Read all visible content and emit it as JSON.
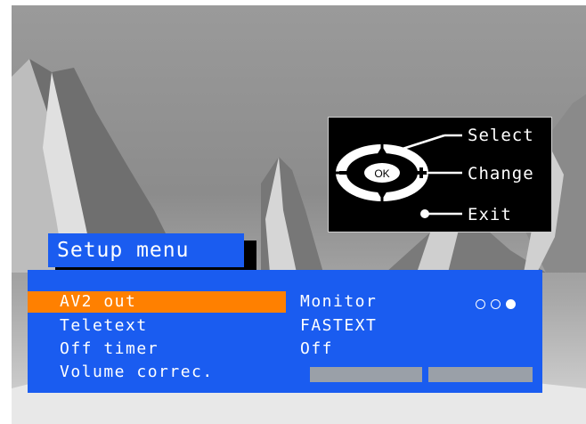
{
  "menu": {
    "title": "Setup menu",
    "items": [
      {
        "label": "AV2 out",
        "value": "Monitor",
        "selected": true
      },
      {
        "label": "Teletext",
        "value": "FASTEXT",
        "selected": false
      },
      {
        "label": "Off timer",
        "value": "Off",
        "selected": false
      },
      {
        "label": "Volume correc.",
        "value": "",
        "selected": false
      }
    ],
    "option_dots": {
      "count": 3,
      "selected_index": 2
    }
  },
  "help": {
    "select_label": "Select",
    "change_label": "Change",
    "exit_label": "Exit",
    "ok_label": "OK"
  },
  "colors": {
    "menu_background": "#1a5cf0",
    "selection_highlight": "#ff8000",
    "text": "#ffffff"
  }
}
